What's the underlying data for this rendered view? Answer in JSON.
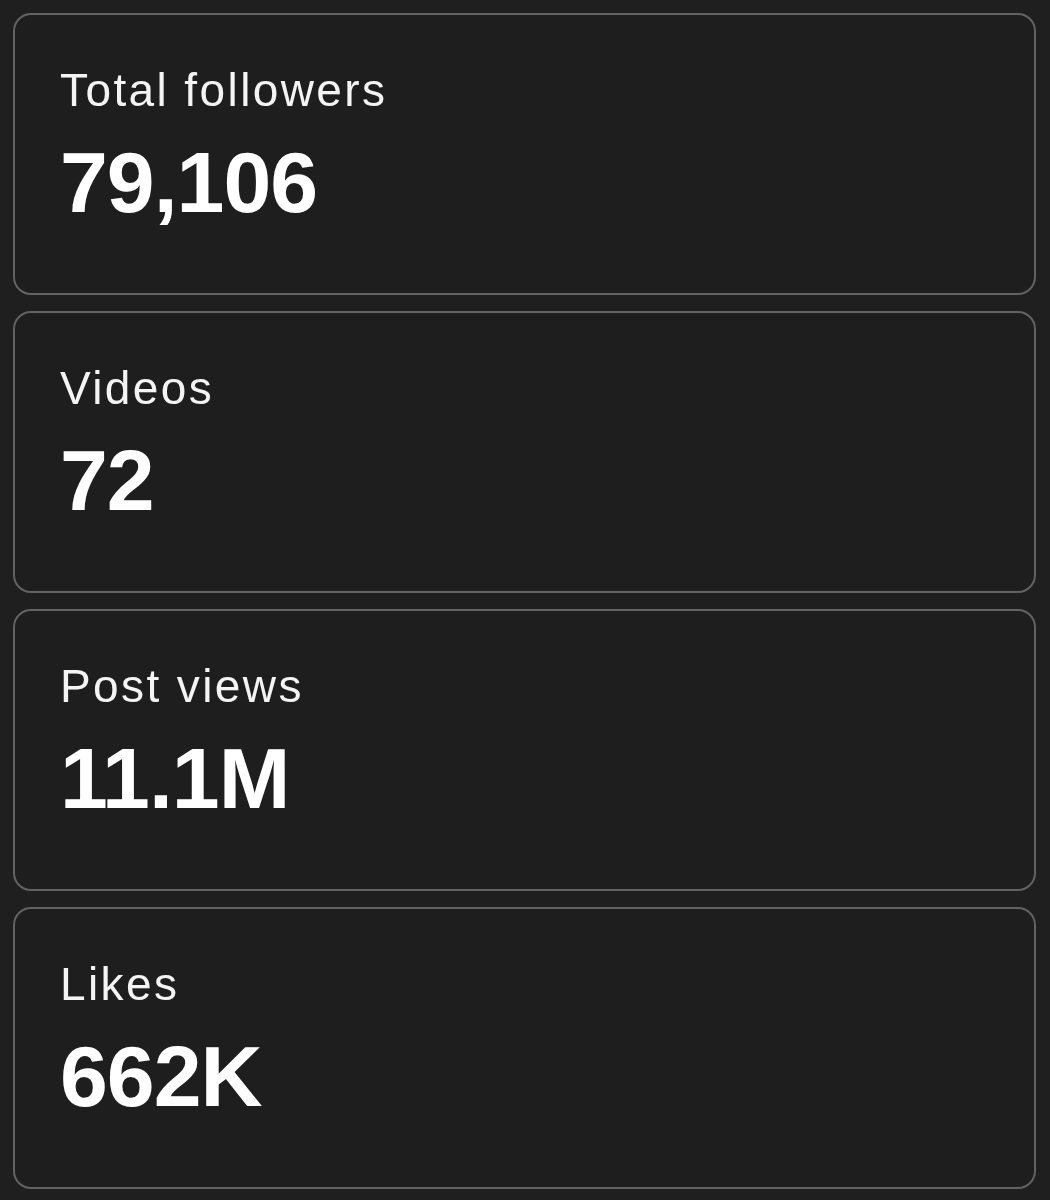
{
  "stats": [
    {
      "label": "Total followers",
      "value": "79,106"
    },
    {
      "label": "Videos",
      "value": "72"
    },
    {
      "label": "Post views",
      "value": "11.1M"
    },
    {
      "label": "Likes",
      "value": "662K"
    }
  ]
}
